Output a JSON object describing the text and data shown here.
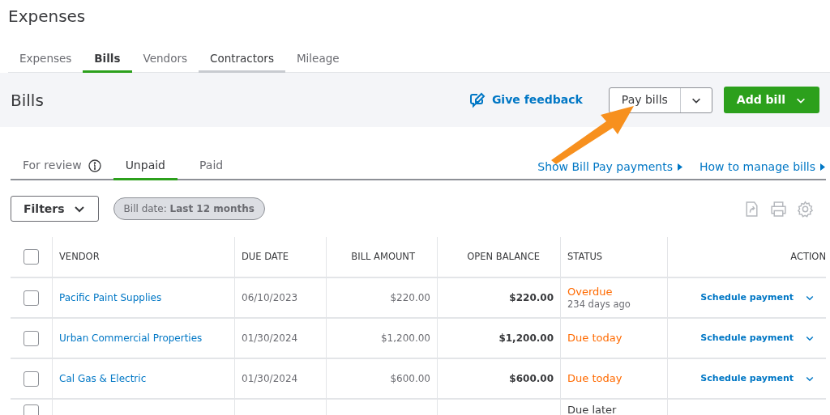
{
  "page_title": "Expenses",
  "tabs": [
    {
      "label": "Expenses",
      "selected": false
    },
    {
      "label": "Bills",
      "selected": true
    },
    {
      "label": "Vendors",
      "selected": false
    },
    {
      "label": "Contractors",
      "selected": false
    },
    {
      "label": "Mileage",
      "selected": false
    }
  ],
  "header": {
    "title": "Bills",
    "feedback_link": "Give feedback",
    "pay_button": "Pay bills",
    "add_button": "Add bill"
  },
  "annotation": {
    "kind": "arrow"
  },
  "subtabs": [
    {
      "label": "For review",
      "info": true,
      "selected": false
    },
    {
      "label": "Unpaid",
      "info": false,
      "selected": true
    },
    {
      "label": "Paid",
      "info": false,
      "selected": false
    }
  ],
  "links": [
    "Show Bill Pay payments",
    "How to manage bills"
  ],
  "filters": {
    "button": "Filters",
    "chip": "Bill date: **Last 12 months**"
  },
  "table": {
    "select_all_checked": false,
    "columns": [
      "VENDOR",
      "DUE DATE",
      "BILL AMOUNT",
      "OPEN BALANCE",
      "STATUS",
      "ACTION"
    ],
    "rows": [
      {
        "checked": false,
        "vendor": "Pacific Paint Supplies",
        "due_date": "06/10/2023",
        "bill_amount": "$220.00",
        "open_balance": "$220.00",
        "status": {
          "text": "Overdue",
          "color": "#ff6a00",
          "note": "234 days ago"
        },
        "action": "Schedule payment"
      },
      {
        "checked": false,
        "vendor": "Urban Commercial Properties",
        "due_date": "01/30/2024",
        "bill_amount": "$1,200.00",
        "open_balance": "$1,200.00",
        "status": {
          "text": "Due today",
          "color": "#ff6a00"
        },
        "action": "Schedule payment"
      },
      {
        "checked": false,
        "vendor": "Cal Gas & Electric",
        "due_date": "01/30/2024",
        "bill_amount": "$600.00",
        "open_balance": "$600.00",
        "status": {
          "text": "Due today",
          "color": "#ff6a00"
        },
        "action": "Schedule payment"
      },
      {
        "checked": false,
        "status": {
          "text": "Due later",
          "color": "#393a3d"
        }
      }
    ]
  }
}
